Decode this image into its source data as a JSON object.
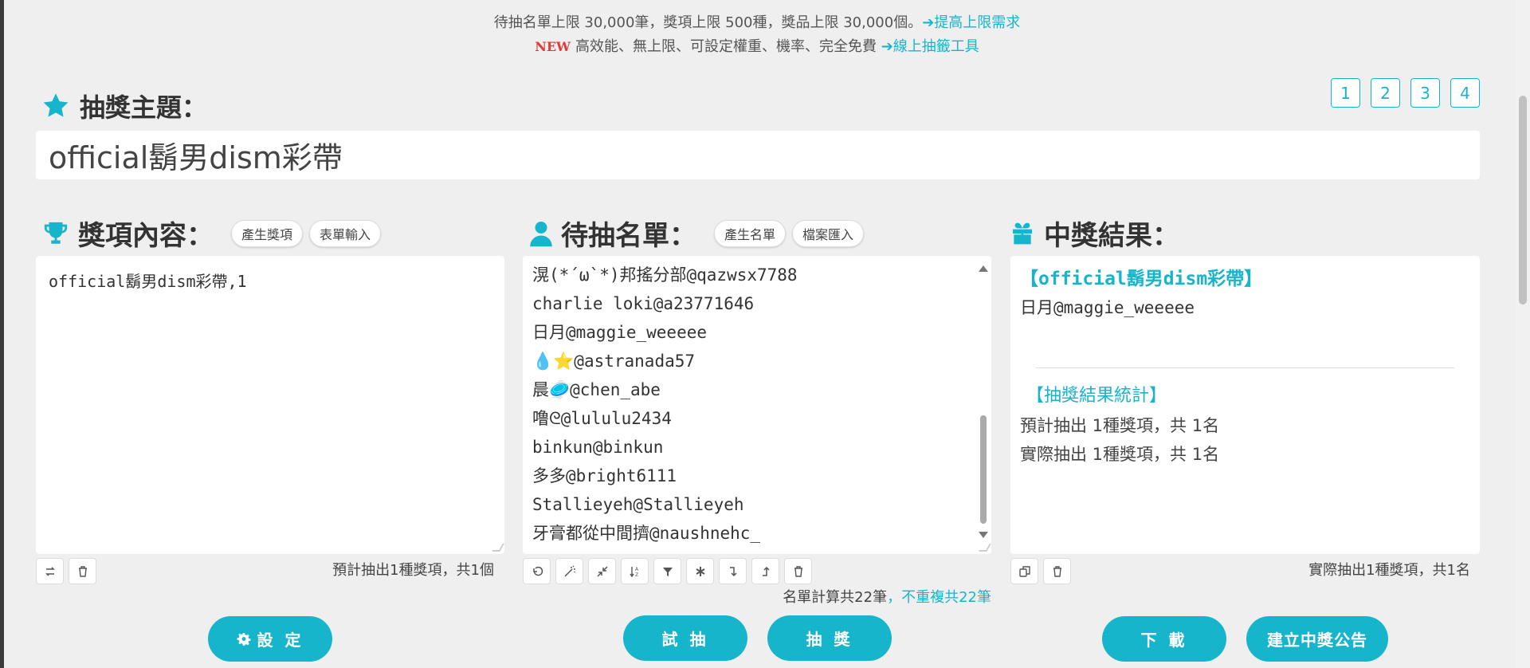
{
  "notice": {
    "line1": "待抽名單上限 30,000筆，獎項上限 500種，獎品上限 30,000個。",
    "line1_link": "➔提高上限需求",
    "new_badge": "NEW",
    "line2": "高效能、無上限、可設定權重、機率、完全免費",
    "line2_link": "➔線上抽籤工具"
  },
  "pages": [
    "1",
    "2",
    "3",
    "4"
  ],
  "topic": {
    "label": "抽獎主題：",
    "value": "official鬍男dism彩帶"
  },
  "prize": {
    "title": "獎項內容：",
    "pill_generate": "產生獎項",
    "pill_form": "表單輸入",
    "content": "official鬍男dism彩帶,1",
    "summary": "預計抽出1種獎項，共1個"
  },
  "names": {
    "title": "待抽名單：",
    "pill_generate": "產生名單",
    "pill_import": "檔案匯入",
    "lines": [
      "滉(*´ω`*)邦搖分部@qazwsx7788",
      "charlie loki@a23771646",
      "日月@maggie_weeeee",
      "💧⭐@astranada57",
      "晨🥏@chen_abe",
      "噜ᘓ@lululu2434",
      "binkun@binkun",
      "多多@bright6111",
      "Stallieyeh@Stallieyeh",
      "牙膏都從中間擠@naushnehc_"
    ],
    "summary": "名單計算共22筆",
    "summary_dedupe": "，不重複共22筆"
  },
  "result": {
    "title": "中獎結果：",
    "prize_title": "【official鬍男dism彩帶】",
    "winner": "日月@maggie_weeeee",
    "stats_title": "【抽獎結果統計】",
    "stat_expected": "預計抽出 1種獎項，共 1名",
    "stat_actual": "實際抽出 1種獎項，共 1名",
    "summary": "實際抽出1種獎項，共1名"
  },
  "buttons": {
    "settings": "設 定",
    "trial": "試 抽",
    "draw": "抽 獎",
    "download": "下 載",
    "announce": "建立中獎公告"
  },
  "colors": {
    "accent": "#17b5cc",
    "background": "#efefef",
    "new_badge": "#e53935"
  }
}
